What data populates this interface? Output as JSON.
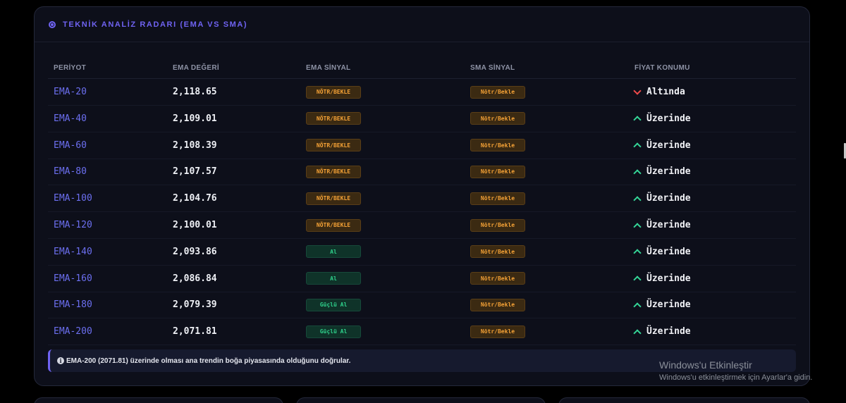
{
  "panel": {
    "title": "TEKNİK ANALİZ RADARI (EMA VS SMA)",
    "icon": "radar-icon"
  },
  "columns": [
    "PERİYOT",
    "EMA DEĞERİ",
    "EMA SİNYAL",
    "SMA SİNYAL",
    "FİYAT KONUMU"
  ],
  "rows": [
    {
      "period": "EMA-20",
      "value": "2,118.65",
      "ema_signal": "NÖTR/BEKLE",
      "ema_type": "neutral",
      "sma_signal": "Nötr/Bekle",
      "position": "Altında",
      "direction": "down"
    },
    {
      "period": "EMA-40",
      "value": "2,109.01",
      "ema_signal": "NÖTR/BEKLE",
      "ema_type": "neutral",
      "sma_signal": "Nötr/Bekle",
      "position": "Üzerinde",
      "direction": "up"
    },
    {
      "period": "EMA-60",
      "value": "2,108.39",
      "ema_signal": "NÖTR/BEKLE",
      "ema_type": "neutral",
      "sma_signal": "Nötr/Bekle",
      "position": "Üzerinde",
      "direction": "up"
    },
    {
      "period": "EMA-80",
      "value": "2,107.57",
      "ema_signal": "NÖTR/BEKLE",
      "ema_type": "neutral",
      "sma_signal": "Nötr/Bekle",
      "position": "Üzerinde",
      "direction": "up"
    },
    {
      "period": "EMA-100",
      "value": "2,104.76",
      "ema_signal": "NÖTR/BEKLE",
      "ema_type": "neutral",
      "sma_signal": "Nötr/Bekle",
      "position": "Üzerinde",
      "direction": "up"
    },
    {
      "period": "EMA-120",
      "value": "2,100.01",
      "ema_signal": "NÖTR/BEKLE",
      "ema_type": "neutral",
      "sma_signal": "Nötr/Bekle",
      "position": "Üzerinde",
      "direction": "up"
    },
    {
      "period": "EMA-140",
      "value": "2,093.86",
      "ema_signal": "Al",
      "ema_type": "buy",
      "sma_signal": "Nötr/Bekle",
      "position": "Üzerinde",
      "direction": "up"
    },
    {
      "period": "EMA-160",
      "value": "2,086.84",
      "ema_signal": "Al",
      "ema_type": "buy",
      "sma_signal": "Nötr/Bekle",
      "position": "Üzerinde",
      "direction": "up"
    },
    {
      "period": "EMA-180",
      "value": "2,079.39",
      "ema_signal": "Güçlü Al",
      "ema_type": "buy",
      "sma_signal": "Nötr/Bekle",
      "position": "Üzerinde",
      "direction": "up"
    },
    {
      "period": "EMA-200",
      "value": "2,071.81",
      "ema_signal": "Güçlü Al",
      "ema_type": "buy",
      "sma_signal": "Nötr/Bekle",
      "position": "Üzerinde",
      "direction": "up"
    }
  ],
  "note": {
    "icon": "info-icon",
    "text": "EMA-200 (2071.81) üzerinde olması ana trendin boğa piyasasında olduğunu doğrular."
  },
  "watermark": {
    "title": "Windows'u Etkinleştir",
    "subtitle": "Windows'u etkinleştirmek için Ayarlar'a gidin."
  },
  "colors": {
    "accent": "#6f63f2",
    "neutral": "#f5a236",
    "buy": "#2fd28c",
    "up": "#35d597",
    "down": "#ee4a4a"
  }
}
